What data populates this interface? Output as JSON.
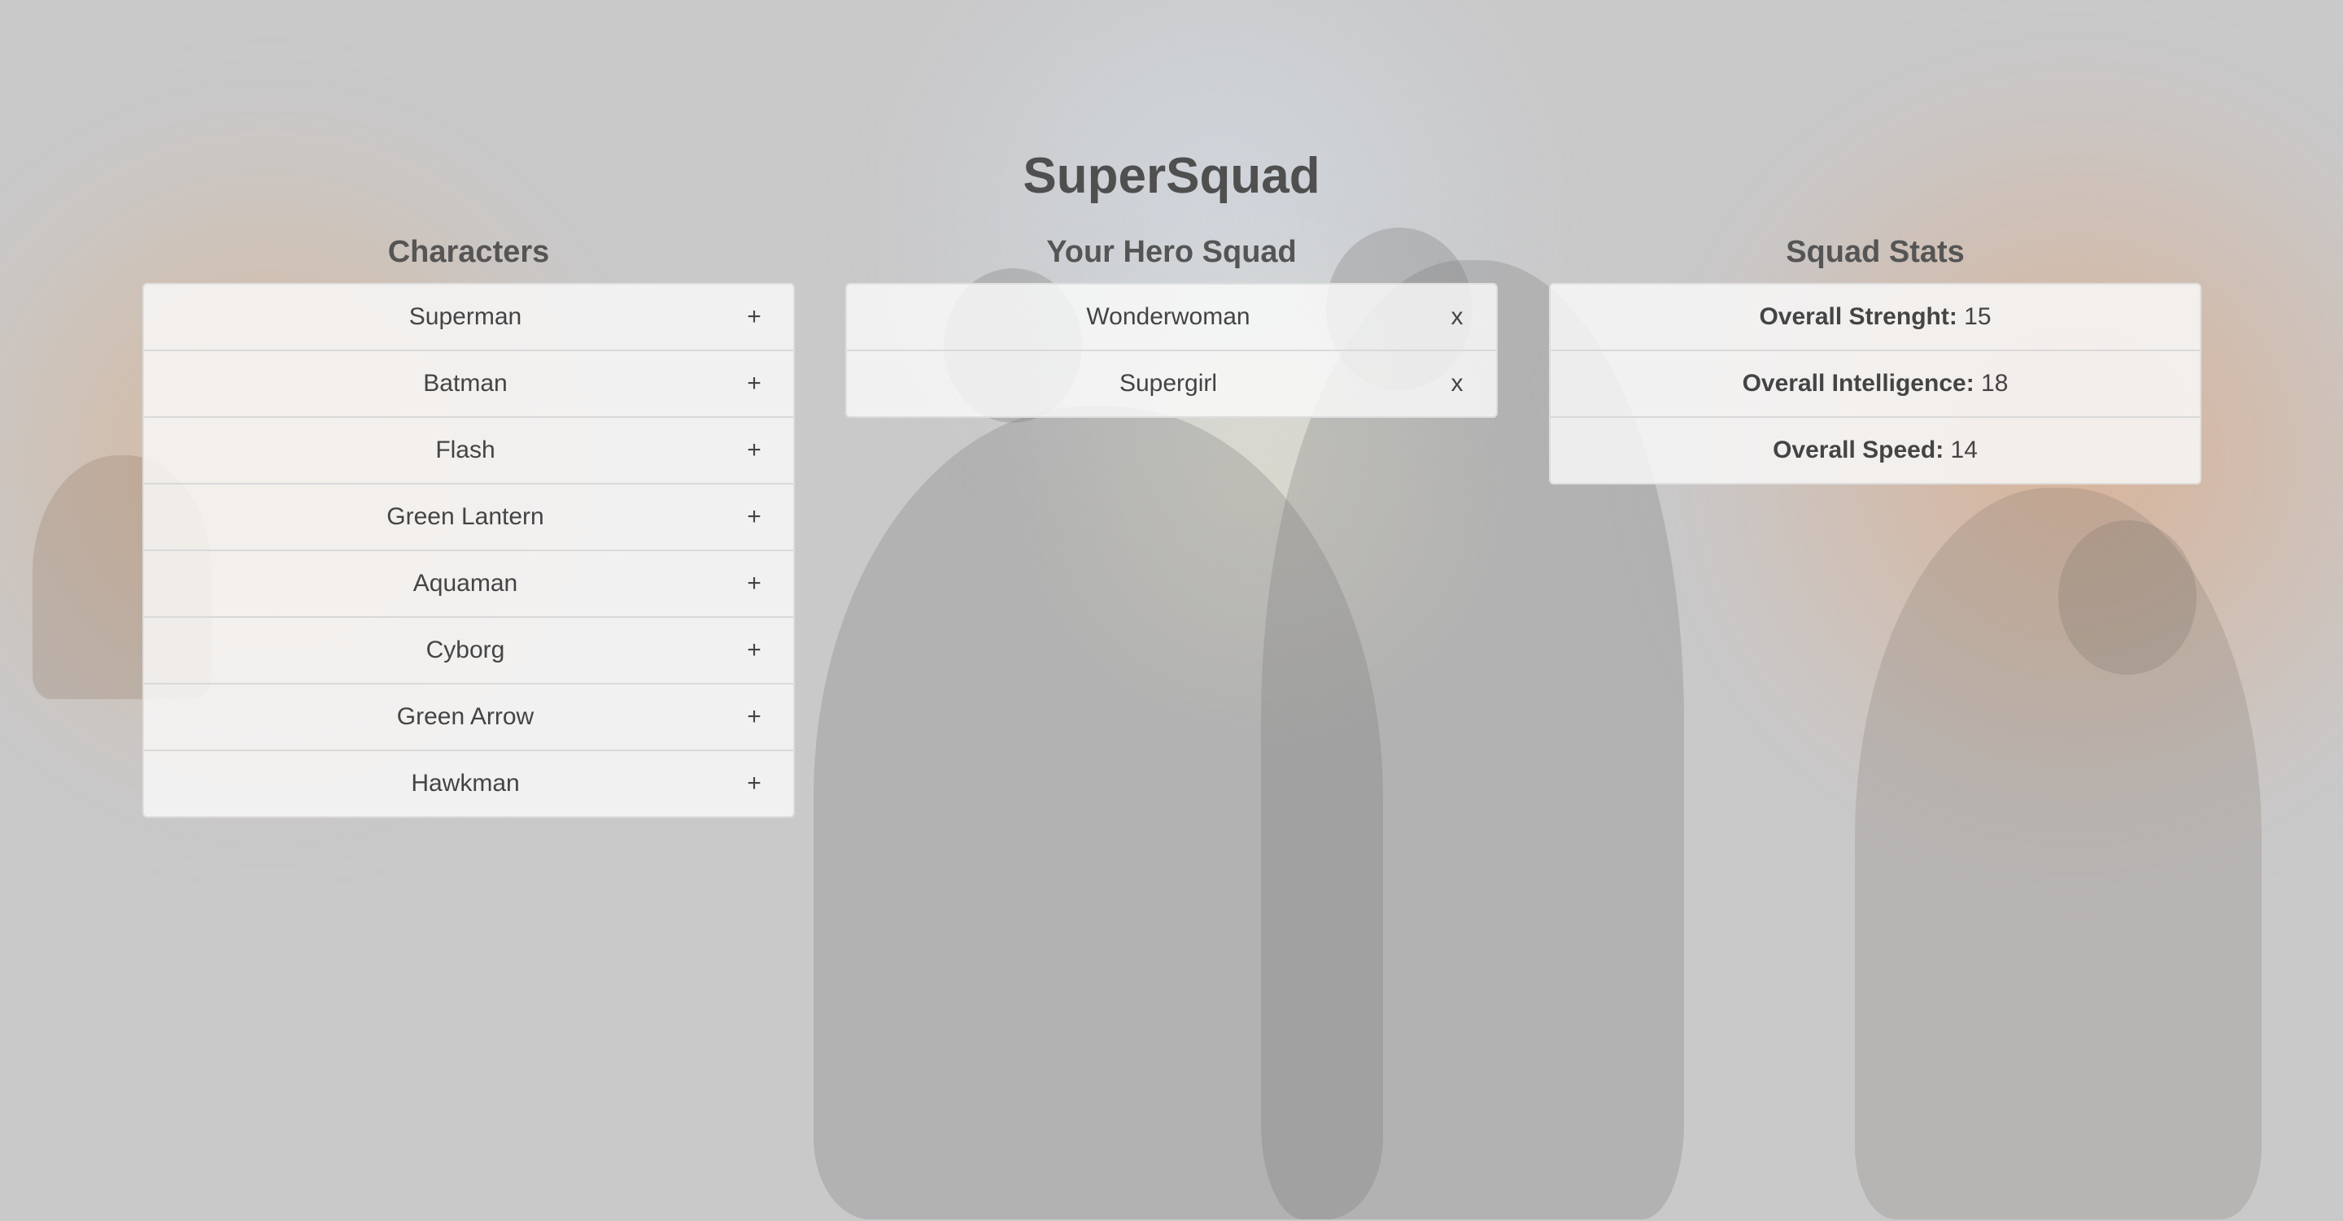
{
  "app": {
    "title": "SuperSquad"
  },
  "characters": {
    "heading": "Characters",
    "action_symbol": "+",
    "items": [
      {
        "name": "Superman"
      },
      {
        "name": "Batman"
      },
      {
        "name": "Flash"
      },
      {
        "name": "Green Lantern"
      },
      {
        "name": "Aquaman"
      },
      {
        "name": "Cyborg"
      },
      {
        "name": "Green Arrow"
      },
      {
        "name": "Hawkman"
      }
    ]
  },
  "squad": {
    "heading": "Your Hero Squad",
    "action_symbol": "x",
    "items": [
      {
        "name": "Wonderwoman"
      },
      {
        "name": "Supergirl"
      }
    ]
  },
  "stats": {
    "heading": "Squad Stats",
    "items": [
      {
        "label": "Overall Strenght:",
        "value": "15"
      },
      {
        "label": "Overall Intelligence:",
        "value": "18"
      },
      {
        "label": "Overall Speed:",
        "value": "14"
      }
    ]
  }
}
